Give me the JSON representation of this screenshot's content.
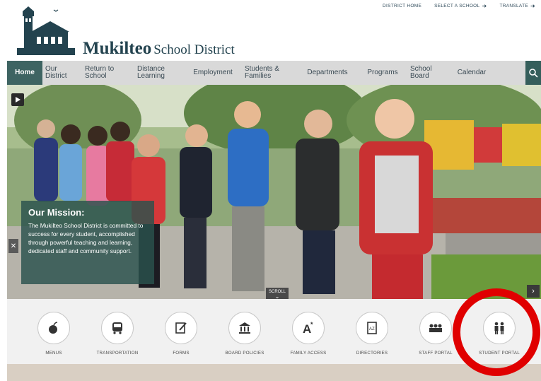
{
  "utility": {
    "district_home": "DISTRICT HOME",
    "select_school": "SELECT A SCHOOL",
    "translate": "TRANSLATE"
  },
  "brand": {
    "name_bold": "Mukilteo",
    "name_rest": "School District"
  },
  "nav": {
    "items": [
      {
        "label": "Home"
      },
      {
        "label": "Our District"
      },
      {
        "label": "Return to School"
      },
      {
        "label": "Distance Learning"
      },
      {
        "label": "Employment"
      },
      {
        "label": "Students & Families"
      },
      {
        "label": "Departments"
      },
      {
        "label": "Programs"
      },
      {
        "label": "School Board"
      },
      {
        "label": "Calendar"
      }
    ],
    "active": "Home"
  },
  "hero": {
    "mission_title": "Our Mission:",
    "mission_body": "The Mukilteo School District is committed to success for every student, accomplished through powerful teaching and learning, dedicated staff and community support.",
    "scroll_label": "SCROLL"
  },
  "quick_links": [
    {
      "label": "MENUS",
      "icon": "apple-icon"
    },
    {
      "label": "TRANSPORTATION",
      "icon": "bus-icon"
    },
    {
      "label": "FORMS",
      "icon": "form-pencil-icon"
    },
    {
      "label": "BOARD POLICIES",
      "icon": "building-icon"
    },
    {
      "label": "FAMILY ACCESS",
      "icon": "grade-a-icon"
    },
    {
      "label": "DIRECTORIES",
      "icon": "directory-book-icon"
    },
    {
      "label": "STAFF PORTAL",
      "icon": "staff-group-icon"
    },
    {
      "label": "STUDENT PORTAL",
      "icon": "students-icon"
    }
  ],
  "colors": {
    "nav_active": "#3e6462",
    "nav_bg": "#d9d9d9",
    "mission_bg": "#2a524d",
    "highlight_ring": "#e00000"
  }
}
